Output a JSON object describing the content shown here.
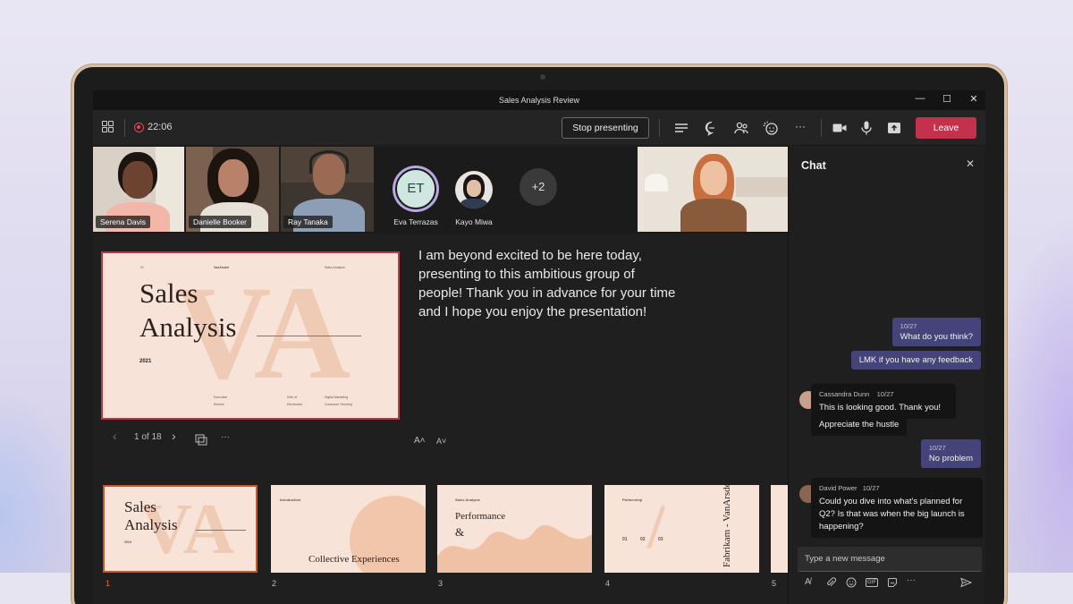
{
  "window": {
    "title": "Sales Analysis Review",
    "minimize": "—",
    "maximize": "☐",
    "close": "✕"
  },
  "toolbar": {
    "timer": "22:06",
    "stop_presenting": "Stop presenting",
    "more": "···",
    "leave": "Leave"
  },
  "participants": [
    {
      "name": "Serena Davis"
    },
    {
      "name": "Danielle Booker"
    },
    {
      "name": "Ray Tanaka"
    },
    {
      "name": "Eva Terrazas",
      "initials": "ET"
    },
    {
      "name": "Kayo Miwa"
    }
  ],
  "overflow_count": "+2",
  "slide": {
    "number": "01",
    "brand": "VanArsdel",
    "label": "Sales Analysis",
    "title_line1": "Sales",
    "title_line2": "Analysis",
    "year": "2021",
    "col1a": "Executive",
    "col1b": "Review",
    "col2a": "Sets of",
    "col2b": "Electronics",
    "col3a": "Digital Marketing",
    "col3b": "Consumer Trending",
    "watermark": "VA"
  },
  "notes": "I am beyond excited to be here today, presenting to this ambitious group of people! Thank you in advance for your time and I hope you enjoy the presentation!",
  "nav": {
    "page": "1 of 18",
    "more": "···",
    "font_up": "A˄",
    "font_down": "A˅"
  },
  "thumbnails": [
    {
      "num": "1",
      "title1": "Sales",
      "title2": "Analysis",
      "year": "2019"
    },
    {
      "num": "2",
      "heading": "Introduction",
      "title": "Collective Experiences"
    },
    {
      "num": "3",
      "heading": "Sales Analysis",
      "title1": "Performance",
      "title2": "&"
    },
    {
      "num": "4",
      "heading": "Partnership",
      "vertical": "Fabrikam - VanArsdel",
      "stats": [
        "01",
        "02",
        "03"
      ]
    },
    {
      "num": "5"
    }
  ],
  "chat": {
    "title": "Chat",
    "messages": [
      {
        "from": "me",
        "time": "10/27",
        "text": "What do you think?"
      },
      {
        "from": "me",
        "text": "LMK if you have any feedback"
      },
      {
        "from": "Cassandra Dunn",
        "time": "10/27",
        "text": "This is looking good. Thank you!"
      },
      {
        "from": "Cassandra Dunn",
        "text": "Appreciate the hustle"
      },
      {
        "from": "me",
        "time": "10/27",
        "text": "No problem"
      },
      {
        "from": "David Power",
        "time": "10/27",
        "text": "Could you dive into what's planned for Q2? Is that was when the big launch is happening?"
      }
    ],
    "compose_placeholder": "Type a new message",
    "gif": "GIF",
    "more": "···"
  },
  "colors": {
    "leave": "#c4314b",
    "my_bubble": "#44447a",
    "slide_bg": "#f7e3d8",
    "selected_thumb": "#c4572f"
  }
}
